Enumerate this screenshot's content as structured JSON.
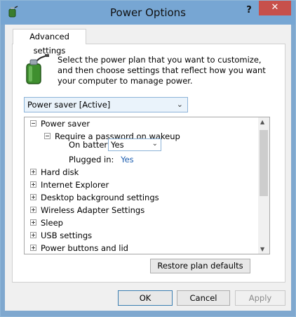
{
  "window": {
    "title": "Power Options",
    "help_label": "?",
    "close_label": "✕"
  },
  "tab": {
    "label": "Advanced settings"
  },
  "description": "Select the power plan that you want to customize, and then choose settings that reflect how you want your computer to manage power.",
  "plan_select": {
    "value": "Power saver [Active]"
  },
  "tree": {
    "items": [
      {
        "label": "Power saver",
        "expanded": true
      },
      {
        "label": "Require a password on wakeup",
        "expanded": true
      },
      {
        "label": "On battery:",
        "value": "Yes"
      },
      {
        "label": "Plugged in:",
        "value": "Yes"
      },
      {
        "label": "Hard disk",
        "expanded": false
      },
      {
        "label": "Internet Explorer",
        "expanded": false
      },
      {
        "label": "Desktop background settings",
        "expanded": false
      },
      {
        "label": "Wireless Adapter Settings",
        "expanded": false
      },
      {
        "label": "Sleep",
        "expanded": false
      },
      {
        "label": "USB settings",
        "expanded": false
      },
      {
        "label": "Power buttons and lid",
        "expanded": false
      }
    ]
  },
  "buttons": {
    "restore": "Restore plan defaults",
    "ok": "OK",
    "cancel": "Cancel",
    "apply": "Apply"
  },
  "colors": {
    "titlebar": "#77a6d3",
    "close": "#c7504b",
    "link_value": "#1f5fb0"
  }
}
